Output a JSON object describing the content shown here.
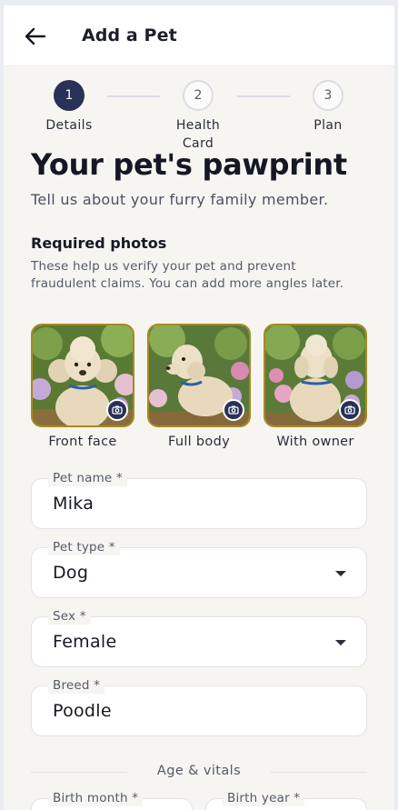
{
  "appbar": {
    "title": "Add a Pet",
    "back_icon": "arrow-left-icon"
  },
  "stepper": {
    "steps": [
      {
        "number": "1",
        "label": "Details",
        "active": true
      },
      {
        "number": "2",
        "label": "Health\nCard",
        "active": false
      },
      {
        "number": "3",
        "label": "Plan",
        "active": false
      }
    ]
  },
  "intro": {
    "heading": "Your pet's pawprint",
    "subheading": "Tell us about your furry family member."
  },
  "photos": {
    "title": "Required photos",
    "description": "These help us verify your pet and prevent fraudulent claims. You can add more angles later.",
    "items": [
      {
        "caption": "Front face",
        "icon": "camera-icon"
      },
      {
        "caption": "Full body",
        "icon": "camera-icon"
      },
      {
        "caption": "With owner",
        "icon": "camera-icon"
      }
    ]
  },
  "form": {
    "pet_name": {
      "label": "Pet name *",
      "value": "Mika"
    },
    "pet_type": {
      "label": "Pet type *",
      "value": "Dog"
    },
    "sex": {
      "label": "Sex *",
      "value": "Female"
    },
    "breed": {
      "label": "Breed *",
      "value": "Poodle"
    }
  },
  "vitals": {
    "section_label": "Age & vitals",
    "birth_month": {
      "label": "Birth month *"
    },
    "birth_year": {
      "label": "Birth year *"
    }
  },
  "colors": {
    "primary": "#2a3157",
    "photo_border": "#a88a1e",
    "background": "#f6f5f2"
  }
}
